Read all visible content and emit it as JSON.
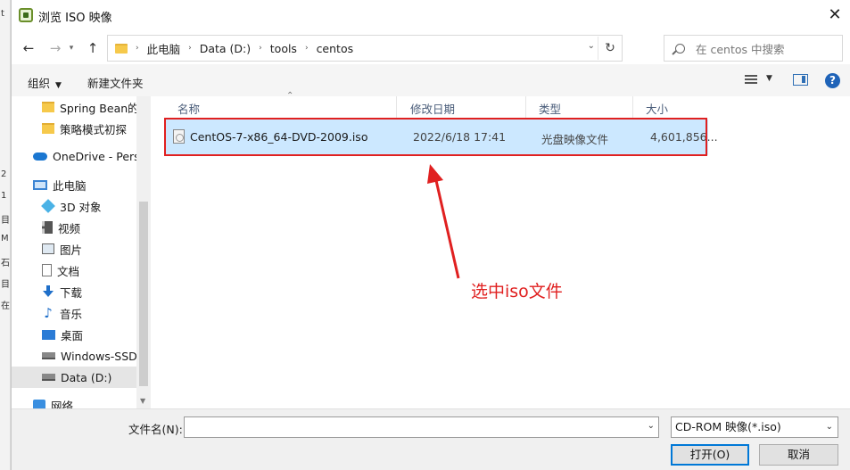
{
  "window": {
    "title": "浏览 ISO 映像"
  },
  "address": {
    "crumbs": [
      "此电脑",
      "Data (D:)",
      "tools",
      "centos"
    ]
  },
  "search": {
    "placeholder": "在 centos 中搜索"
  },
  "toolbar": {
    "organize": "组织",
    "new_folder": "新建文件夹"
  },
  "nav": {
    "items": [
      {
        "label": "Spring Bean的生命周期",
        "icon": "folder-icon"
      },
      {
        "label": "策略模式初探",
        "icon": "folder-icon"
      },
      {
        "label": "OneDrive - Personal",
        "icon": "onedrive-icon"
      },
      {
        "label": "此电脑",
        "icon": "this-pc-icon"
      },
      {
        "label": "3D 对象",
        "icon": "3d-objects-icon"
      },
      {
        "label": "视频",
        "icon": "video-icon"
      },
      {
        "label": "图片",
        "icon": "picture-icon"
      },
      {
        "label": "文档",
        "icon": "document-icon"
      },
      {
        "label": "下载",
        "icon": "download-icon"
      },
      {
        "label": "音乐",
        "icon": "music-icon"
      },
      {
        "label": "桌面",
        "icon": "desktop-icon"
      },
      {
        "label": "Windows-SSD",
        "icon": "drive-icon"
      },
      {
        "label": "Data (D:)",
        "icon": "drive-icon"
      },
      {
        "label": "网络",
        "icon": "network-icon"
      }
    ]
  },
  "columns": {
    "name": "名称",
    "modified": "修改日期",
    "type": "类型",
    "size": "大小"
  },
  "files": [
    {
      "name": "CentOS-7-x86_64-DVD-2009.iso",
      "modified": "2022/6/18 17:41",
      "type": "光盘映像文件",
      "size": "4,601,856..."
    }
  ],
  "annotation": {
    "text": "选中iso文件",
    "color": "#e02020"
  },
  "bottom": {
    "filename_label": "文件名(N):",
    "filename_value": "",
    "filter": "CD-ROM 映像(*.iso)",
    "open": "打开(O)",
    "cancel": "取消"
  }
}
